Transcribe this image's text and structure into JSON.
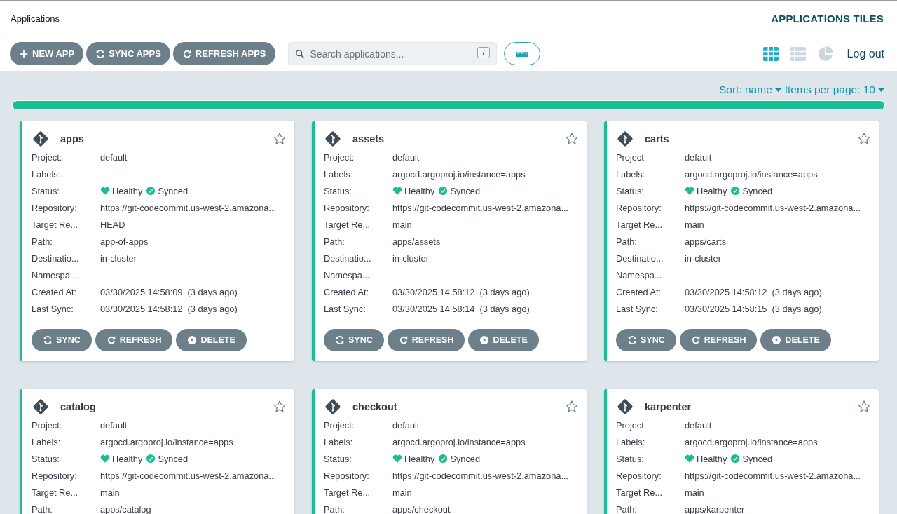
{
  "header": {
    "title": "Applications",
    "view_title": "APPLICATIONS TILES"
  },
  "toolbar": {
    "buttons": [
      {
        "label": "NEW APP",
        "kind": "plus"
      },
      {
        "label": "SYNC APPS",
        "kind": "sync"
      },
      {
        "label": "REFRESH APPS",
        "kind": "refresh"
      }
    ],
    "search": {
      "placeholder": "Search applications...",
      "shortcut": "/"
    },
    "views": [
      {
        "kind": "tiles",
        "selected": true
      },
      {
        "kind": "list",
        "selected": false
      },
      {
        "kind": "summary",
        "selected": false
      }
    ],
    "logout": "Log out"
  },
  "sort": {
    "sort": "Sort: name",
    "items_per_page": "Items per page: 10"
  },
  "progress": {
    "level": 1
  },
  "apps": [
    {
      "name": "apps",
      "starred": false,
      "fields": [
        {
          "label": "Project:",
          "value": "default"
        },
        {
          "label": "Labels:"
        },
        {
          "label": "Status:",
          "kind": "status",
          "health": "Healthy",
          "sync": "Synced"
        },
        {
          "label": "Repository:",
          "value": "https://git-codecommit.us-west-2.amazona..."
        },
        {
          "label": "Target Re...",
          "value": "HEAD"
        },
        {
          "label": "Path:",
          "value": "app-of-apps"
        },
        {
          "label": "Destinatio...",
          "value": "in-cluster"
        },
        {
          "label": "Namespa..."
        },
        {
          "label": "Created At:",
          "value": "03/30/2025 14:58:09  (3 days ago)"
        },
        {
          "label": "Last Sync:",
          "value": "03/30/2025 14:58:12  (3 days ago)"
        }
      ],
      "actions": [
        {
          "label": "SYNC",
          "kind": "sync"
        },
        {
          "label": "REFRESH",
          "kind": "refresh"
        },
        {
          "label": "DELETE",
          "kind": "delete"
        }
      ]
    },
    {
      "name": "assets",
      "starred": false,
      "fields": [
        {
          "label": "Project:",
          "value": "default"
        },
        {
          "label": "Labels:",
          "value": "argocd.argoproj.io/instance=apps"
        },
        {
          "label": "Status:",
          "kind": "status",
          "health": "Healthy",
          "sync": "Synced"
        },
        {
          "label": "Repository:",
          "value": "https://git-codecommit.us-west-2.amazona..."
        },
        {
          "label": "Target Re...",
          "value": "main"
        },
        {
          "label": "Path:",
          "value": "apps/assets"
        },
        {
          "label": "Destinatio...",
          "value": "in-cluster"
        },
        {
          "label": "Namespa..."
        },
        {
          "label": "Created At:",
          "value": "03/30/2025 14:58:12  (3 days ago)"
        },
        {
          "label": "Last Sync:",
          "value": "03/30/2025 14:58:14  (3 days ago)"
        }
      ],
      "actions": [
        {
          "label": "SYNC",
          "kind": "sync"
        },
        {
          "label": "REFRESH",
          "kind": "refresh"
        },
        {
          "label": "DELETE",
          "kind": "delete"
        }
      ]
    },
    {
      "name": "carts",
      "starred": false,
      "fields": [
        {
          "label": "Project:",
          "value": "default"
        },
        {
          "label": "Labels:",
          "value": "argocd.argoproj.io/instance=apps"
        },
        {
          "label": "Status:",
          "kind": "status",
          "health": "Healthy",
          "sync": "Synced"
        },
        {
          "label": "Repository:",
          "value": "https://git-codecommit.us-west-2.amazona..."
        },
        {
          "label": "Target Re...",
          "value": "main"
        },
        {
          "label": "Path:",
          "value": "apps/carts"
        },
        {
          "label": "Destinatio...",
          "value": "in-cluster"
        },
        {
          "label": "Namespa..."
        },
        {
          "label": "Created At:",
          "value": "03/30/2025 14:58:12  (3 days ago)"
        },
        {
          "label": "Last Sync:",
          "value": "03/30/2025 14:58:15  (3 days ago)"
        }
      ],
      "actions": [
        {
          "label": "SYNC",
          "kind": "sync"
        },
        {
          "label": "REFRESH",
          "kind": "refresh"
        },
        {
          "label": "DELETE",
          "kind": "delete"
        }
      ]
    },
    {
      "name": "catalog",
      "starred": false,
      "fields": [
        {
          "label": "Project:",
          "value": "default"
        },
        {
          "label": "Labels:",
          "value": "argocd.argoproj.io/instance=apps"
        },
        {
          "label": "Status:",
          "kind": "status",
          "health": "Healthy",
          "sync": "Synced"
        },
        {
          "label": "Repository:",
          "value": "https://git-codecommit.us-west-2.amazona..."
        },
        {
          "label": "Target Re...",
          "value": "main"
        },
        {
          "label": "Path:",
          "value": "apps/catalog"
        }
      ]
    },
    {
      "name": "checkout",
      "starred": false,
      "fields": [
        {
          "label": "Project:",
          "value": "default"
        },
        {
          "label": "Labels:",
          "value": "argocd.argoproj.io/instance=apps"
        },
        {
          "label": "Status:",
          "kind": "status",
          "health": "Healthy",
          "sync": "Synced"
        },
        {
          "label": "Repository:",
          "value": "https://git-codecommit.us-west-2.amazona..."
        },
        {
          "label": "Target Re...",
          "value": "main"
        },
        {
          "label": "Path:",
          "value": "apps/checkout"
        }
      ]
    },
    {
      "name": "karpenter",
      "starred": false,
      "fields": [
        {
          "label": "Project:",
          "value": "default"
        },
        {
          "label": "Labels:",
          "value": "argocd.argoproj.io/instance=apps"
        },
        {
          "label": "Status:",
          "kind": "status",
          "health": "Healthy",
          "sync": "Synced"
        },
        {
          "label": "Repository:",
          "value": "https://git-codecommit.us-west-2.amazona..."
        },
        {
          "label": "Target Re...",
          "value": "main"
        },
        {
          "label": "Path:",
          "value": "apps/karpenter"
        }
      ]
    }
  ]
}
